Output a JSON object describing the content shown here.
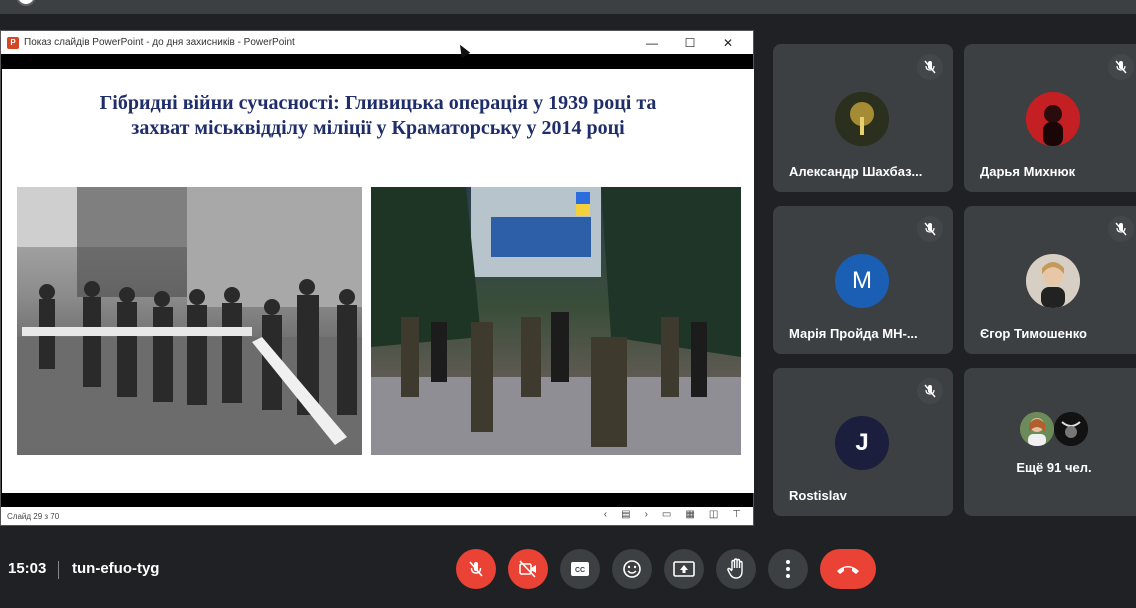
{
  "ppt": {
    "title": "Показ слайдів PowerPoint  -  до дня захисників  -  PowerPoint",
    "logo": "P",
    "window_buttons": [
      "—",
      "☐",
      "✕"
    ],
    "slide_title_line1": "Гібридні війни сучасності: Гливицька операція у 1939 році та",
    "slide_title_line2": "захват міськвідділу міліції у Краматорську у 2014 році",
    "status": "Слайд 29 з 70",
    "status_controls": [
      "‹",
      "▤",
      "›",
      "▭",
      "▦",
      "◫",
      "⊤"
    ]
  },
  "participants": [
    {
      "name": "Александр Шахбаз...",
      "avatar_color": "#2b2f1d",
      "muted": true
    },
    {
      "name": "Дарья Михнюк",
      "avatar_color": "#c41f22",
      "muted": true
    },
    {
      "name": "Марія Пройда МН-...",
      "initial": "M",
      "avatar_color": "#1a5fb4",
      "muted": true
    },
    {
      "name": "Єгор Тимошенко",
      "avatar_color": "#8a7a6a",
      "muted": true
    },
    {
      "name": "Rostislav",
      "initial": "J",
      "avatar_color": "#1b1e3c",
      "muted": true
    }
  ],
  "more": {
    "label": "Ещё 91 чел."
  },
  "meeting": {
    "time": "15:03",
    "code": "tun-efuo-tyg"
  },
  "controls": {
    "mic": "mic-off-icon",
    "camera": "camera-off-icon",
    "captions": "CC",
    "emoji": "emoji-icon",
    "present": "present-icon",
    "hand": "raise-hand-icon",
    "more": "more-vert-icon",
    "end": "end-call-icon"
  },
  "colors": {
    "background": "#202124",
    "tile": "#3c4043",
    "red": "#ea4335",
    "slide_title": "#1f2d6b"
  }
}
